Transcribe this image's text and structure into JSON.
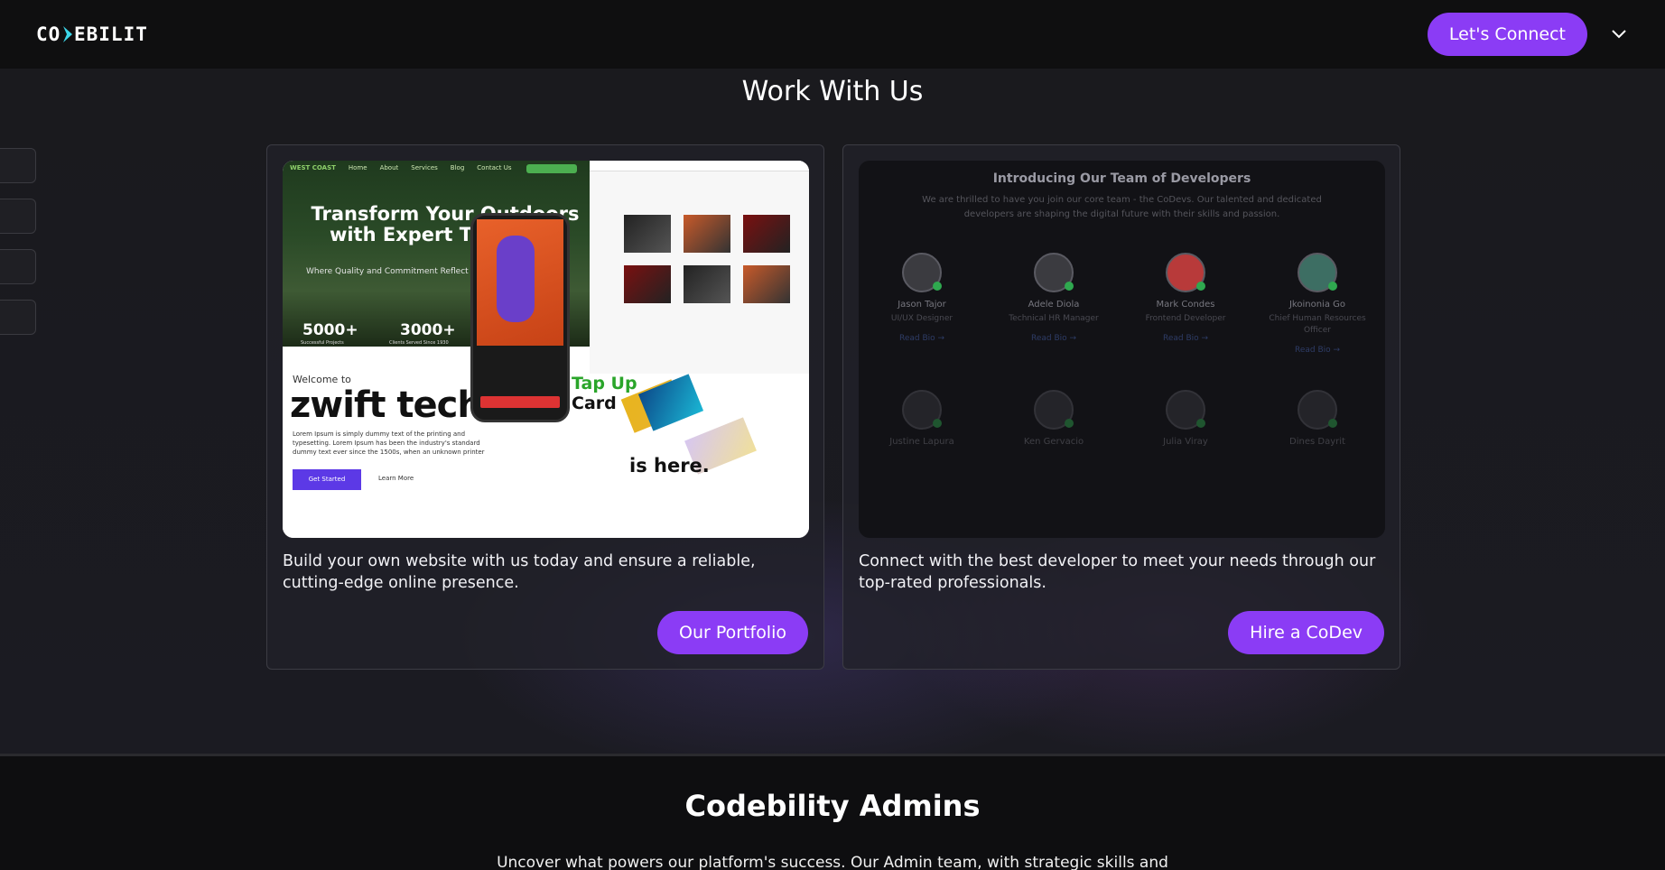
{
  "nav": {
    "logo": "CODEBILITY",
    "connect_label": "Let's Connect"
  },
  "work": {
    "title": "Work With Us",
    "portfolio": {
      "description": "Build your own website with us today and ensure a reliable, cutting-edge online presence.",
      "button": "Our Portfolio",
      "preview": {
        "nav_items": [
          "Home",
          "About",
          "Services",
          "Blog",
          "Contact Us"
        ],
        "headline": "Transform Your Outdoors with Expert Tree Care",
        "subline": "Where Quality and Commitment Reflect Customer",
        "stat1_value": "5000+",
        "stat1_label": "Successful Projects",
        "stat2_value": "3000+",
        "stat2_label": "Clients Served Since 1930",
        "welcome": "Welcome to",
        "brand": "zwift tech.",
        "lorem": "Lorem Ipsum is simply dummy text of the printing and typesetting. Lorem Ipsum has been the industry's standard dummy text ever since the 1500s, when an unknown printer",
        "get_started": "Get Started",
        "learn_more": "Learn More",
        "tap_line1": "Tap Up",
        "tap_line2": "Card",
        "tap_line3": "is here."
      }
    },
    "codev": {
      "description": "Connect with the best developer to meet your needs through our top-rated professionals.",
      "button": "Hire a CoDev",
      "preview": {
        "title": "Introducing Our Team of Developers",
        "intro": "We are thrilled to have you join our core team - the CoDevs. Our talented and dedicated developers are shaping the digital future with their skills and passion.",
        "read_bio": "Read Bio →",
        "developers": [
          {
            "name": "Jason Tajor",
            "role": "UI/UX Designer"
          },
          {
            "name": "Adele Diola",
            "role": "Technical HR Manager"
          },
          {
            "name": "Mark Condes",
            "role": "Frontend Developer"
          },
          {
            "name": "Jkoinonia Go",
            "role": "Chief Human Resources Officer"
          },
          {
            "name": "Justine Lapura",
            "role": ""
          },
          {
            "name": "Ken Gervacio",
            "role": ""
          },
          {
            "name": "Julia Viray",
            "role": ""
          },
          {
            "name": "Dines Dayrit",
            "role": ""
          }
        ]
      }
    }
  },
  "admins": {
    "title": "Codebility Admins",
    "description": "Uncover what powers our platform's success. Our Admin team, with strategic skills and"
  },
  "colors": {
    "accent": "#8b3cf5",
    "background": "#17171b",
    "navbar": "#0f0f10"
  },
  "icons": {
    "nav_chevron": "chevron-down-icon",
    "arrow": "arrow-right-icon"
  }
}
